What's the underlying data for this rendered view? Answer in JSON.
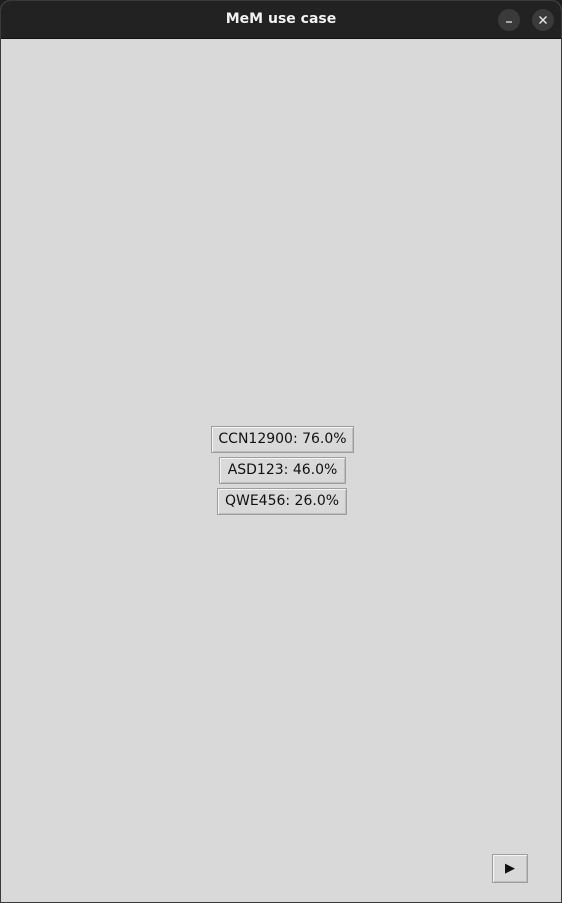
{
  "window": {
    "title": "MeM use case",
    "minimize_icon": "minimize-icon",
    "close_icon": "close-icon"
  },
  "main": {
    "buttons": [
      {
        "label": "CCN12900: 76.0%"
      },
      {
        "label": "ASD123: 46.0%"
      },
      {
        "label": "QWE456: 26.0%"
      }
    ],
    "play_button": {
      "label": "▶",
      "icon": "play-icon"
    }
  }
}
